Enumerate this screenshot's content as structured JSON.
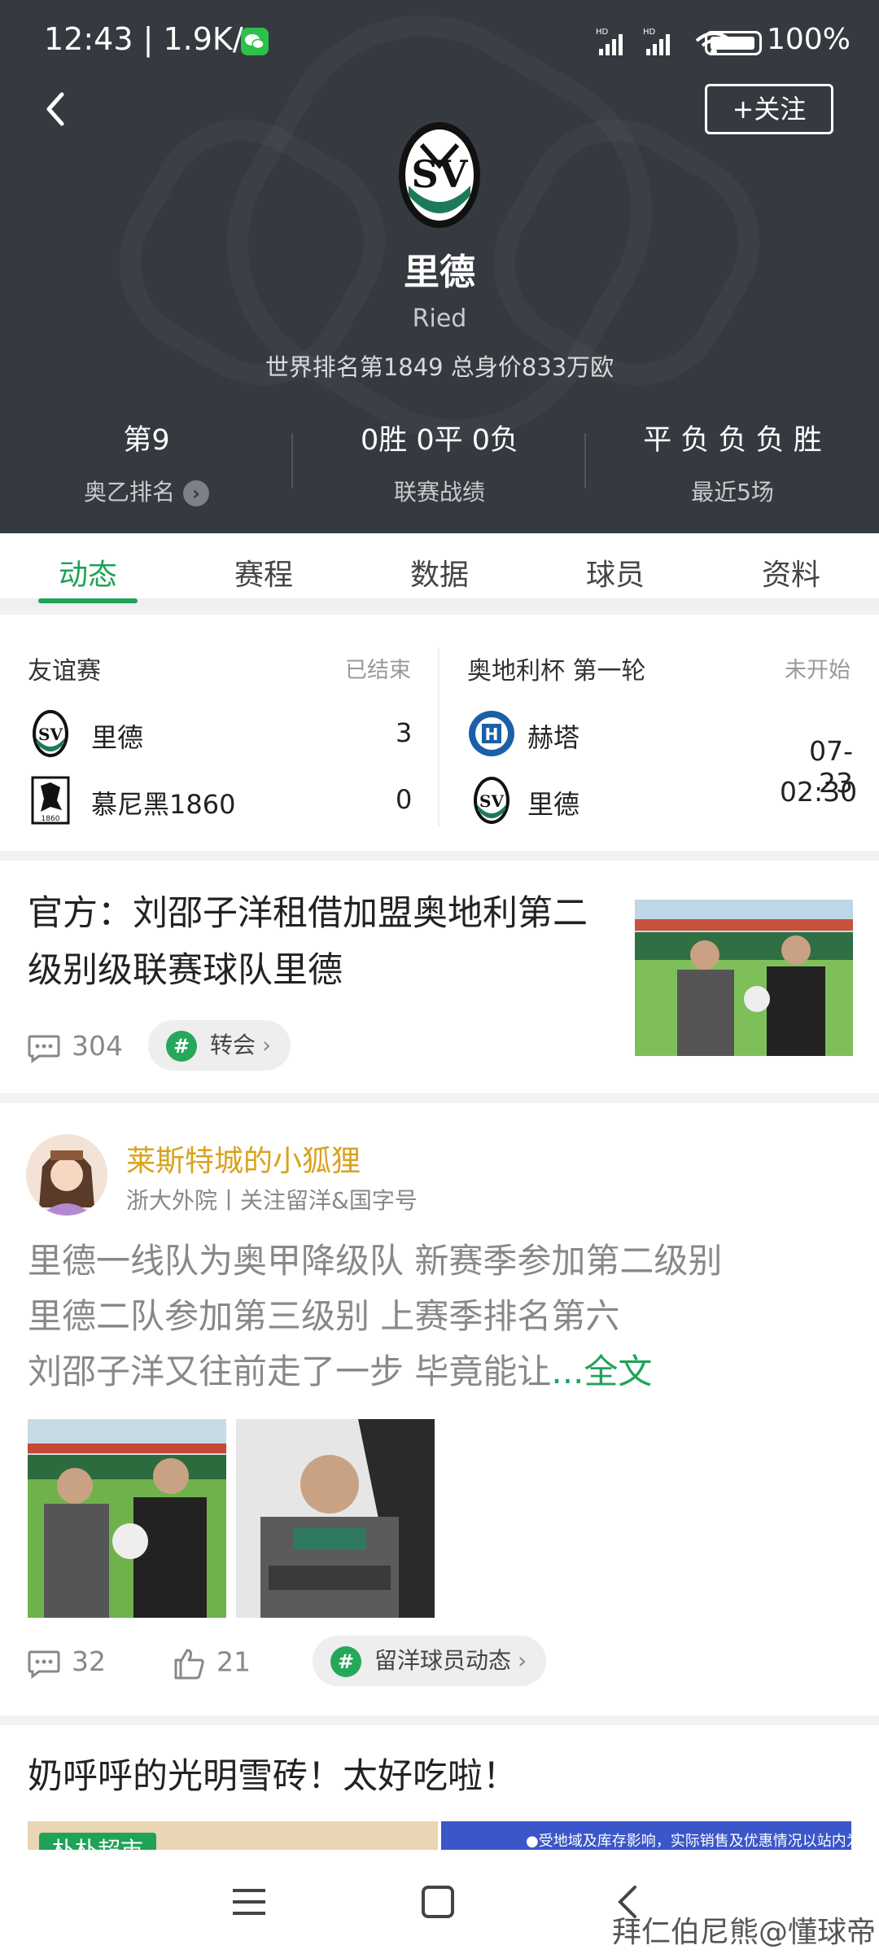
{
  "status_bar": {
    "time": "12:43 | 1.9K/s",
    "battery": "100%"
  },
  "header": {
    "follow_label": "+关注",
    "team_name_cn": "里德",
    "team_name_en": "Ried",
    "rank_line": "世界排名第1849  总身价833万欧",
    "stats": [
      {
        "value": "第9",
        "label": "奥乙排名"
      },
      {
        "value": "0胜 0平 0负",
        "label": "联赛战绩"
      },
      {
        "value": "平 负 负 负 胜",
        "label": "最近5场"
      }
    ]
  },
  "tabs": [
    "动态",
    "赛程",
    "数据",
    "球员",
    "资料"
  ],
  "matches": [
    {
      "competition": "友谊赛",
      "status": "已结束",
      "home": "里德",
      "home_score": "3",
      "away": "慕尼黑1860",
      "away_score": "0"
    },
    {
      "competition": "奥地利杯 第一轮",
      "status": "未开始",
      "home": "赫塔",
      "away": "里德",
      "date": "07-23",
      "time": "02:30"
    }
  ],
  "news": {
    "title": "官方：刘邵子洋租借加盟奥地利第二级别级联赛球队里德",
    "comments": "304",
    "tag": "转会"
  },
  "post": {
    "author": "莱斯特城的小狐狸",
    "author_sub": "浙大外院丨关注留洋&国字号",
    "lines": [
      "里德一线队为奥甲降级队 新赛季参加第二级别",
      "里德二队参加第三级别 上赛季排名第六",
      "刘邵子洋又往前走了一步 毕竟能让"
    ],
    "more": "...全文",
    "comments": "32",
    "likes": "21",
    "tag": "留洋球员动态"
  },
  "ad": {
    "title": "奶呼呼的光明雪砖！太好吃啦！",
    "badge": "朴朴超市",
    "note": "●受地域及库存影响，实际销售及优惠情况以站内为准●"
  },
  "watermark": "拜仁伯尼熊@懂球帝",
  "colors": {
    "header_bg": "#353a40",
    "accent_green": "#1fa357",
    "author_gold": "#d9a21b"
  }
}
